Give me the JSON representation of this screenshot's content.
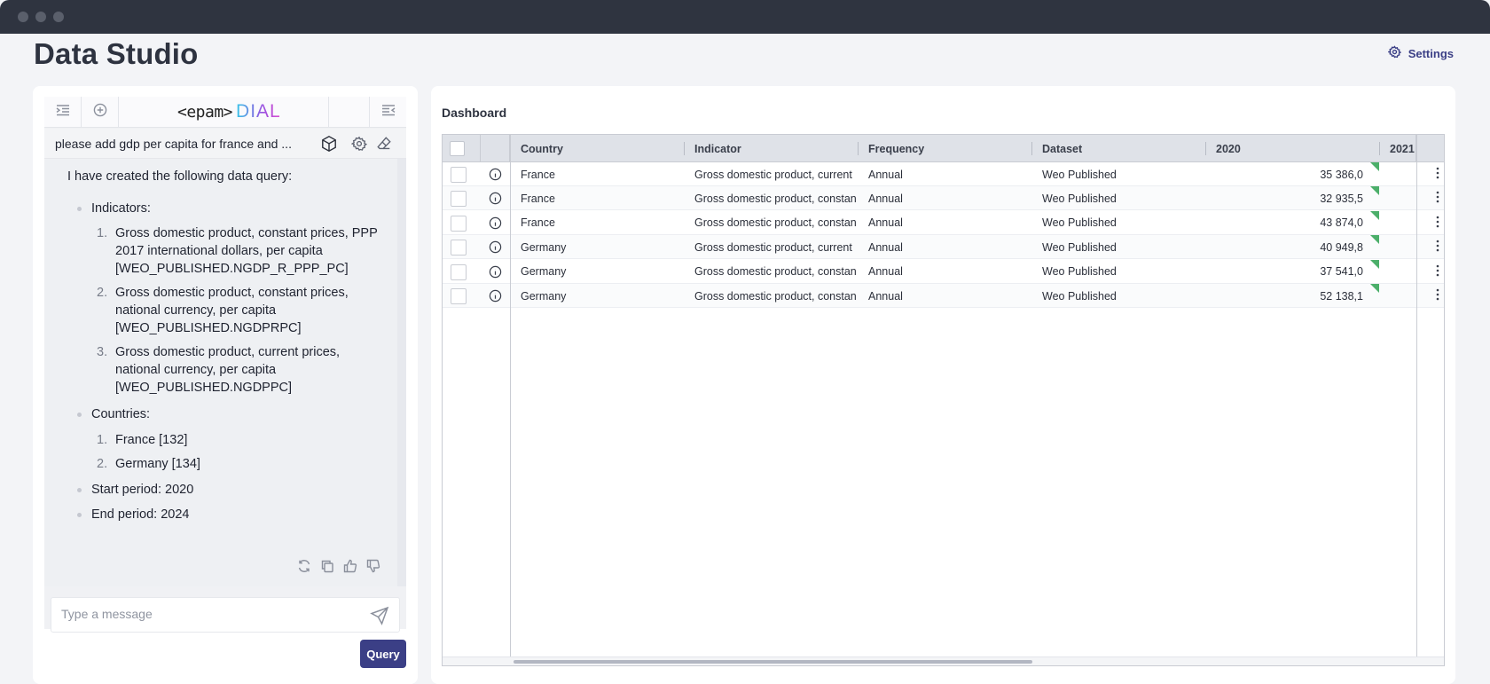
{
  "window": {
    "dots": [
      "close",
      "minimize",
      "maximize"
    ]
  },
  "page": {
    "title": "Data Studio",
    "settings_label": "Settings"
  },
  "chat": {
    "logo_epam": "<epam>",
    "logo_dial": "DIAL",
    "conversation_title": "please add gdp per capita for france and ...",
    "message": {
      "intro": "I have created the following data query:",
      "indicators_label": "Indicators:",
      "indicators": [
        "Gross domestic product, constant prices, PPP 2017 international dollars, per capita [WEO_PUBLISHED.NGDP_R_PPP_PC]",
        "Gross domestic product, constant prices, national currency, per capita [WEO_PUBLISHED.NGDPRPC]",
        "Gross domestic product, current prices, national currency, per capita [WEO_PUBLISHED.NGDPPC]"
      ],
      "countries_label": "Countries:",
      "countries": [
        "France [132]",
        "Germany [134]"
      ],
      "start_period": "Start period: 2020",
      "end_period": "End period: 2024"
    },
    "input_placeholder": "Type a message",
    "query_button": "Query"
  },
  "dashboard": {
    "title": "Dashboard",
    "columns": [
      "Country",
      "Indicator",
      "Frequency",
      "Dataset",
      "2020",
      "2021"
    ],
    "rows": [
      {
        "country": "France",
        "indicator": "Gross domestic product, current",
        "frequency": "Annual",
        "dataset": "Weo Published",
        "y2020": "35 386,0"
      },
      {
        "country": "France",
        "indicator": "Gross domestic product, constan",
        "frequency": "Annual",
        "dataset": "Weo Published",
        "y2020": "32 935,5"
      },
      {
        "country": "France",
        "indicator": "Gross domestic product, constan",
        "frequency": "Annual",
        "dataset": "Weo Published",
        "y2020": "43 874,0"
      },
      {
        "country": "Germany",
        "indicator": "Gross domestic product, current",
        "frequency": "Annual",
        "dataset": "Weo Published",
        "y2020": "40 949,8"
      },
      {
        "country": "Germany",
        "indicator": "Gross domestic product, constan",
        "frequency": "Annual",
        "dataset": "Weo Published",
        "y2020": "37 541,0"
      },
      {
        "country": "Germany",
        "indicator": "Gross domestic product, constan",
        "frequency": "Annual",
        "dataset": "Weo Published",
        "y2020": "52 138,1"
      }
    ]
  },
  "colors": {
    "accent": "#3b3f86",
    "titlebar": "#2f3440",
    "flag": "#4caf6a"
  }
}
